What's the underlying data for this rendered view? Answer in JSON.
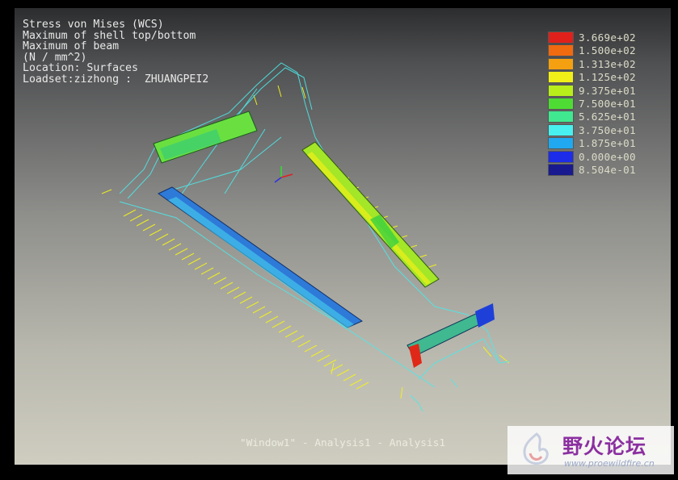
{
  "info": {
    "lines": [
      "Stress von Mises (WCS)",
      "Maximum of shell top/bottom",
      "Maximum of beam",
      "(N / mm^2)",
      "Location: Surfaces",
      "Loadset:zizhong :  ZHUANGPEI2"
    ]
  },
  "legend": [
    {
      "value": "3.669e+02",
      "color": "#e0201a"
    },
    {
      "value": "1.500e+02",
      "color": "#f06a10"
    },
    {
      "value": "1.313e+02",
      "color": "#f4a010"
    },
    {
      "value": "1.125e+02",
      "color": "#f0f018"
    },
    {
      "value": "9.375e+01",
      "color": "#b8ee1a"
    },
    {
      "value": "7.500e+01",
      "color": "#4edc34"
    },
    {
      "value": "5.625e+01",
      "color": "#40e890"
    },
    {
      "value": "3.750e+01",
      "color": "#48f0f0"
    },
    {
      "value": "1.875e+01",
      "color": "#20a8f0"
    },
    {
      "value": "0.000e+00",
      "color": "#1c2ce8"
    },
    {
      "value": "8.504e-01",
      "color": "#1a1a90"
    }
  ],
  "footer": "\"Window1\" - Analysis1 - Analysis1",
  "watermark": {
    "title": "野火论坛",
    "url": "www.proewildfire.cn"
  }
}
